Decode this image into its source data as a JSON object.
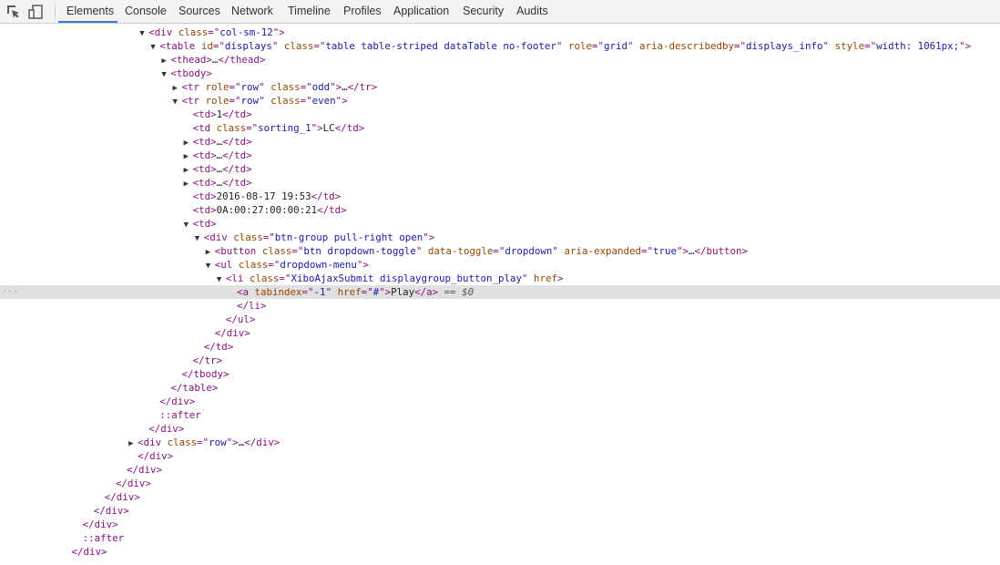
{
  "toolbar": {
    "icons": [
      "inspect-icon",
      "device-mode-icon"
    ],
    "tabs": [
      "Elements",
      "Console",
      "Sources",
      "Network",
      "Timeline",
      "Profiles",
      "Application",
      "Security",
      "Audits"
    ],
    "active_tab": "Elements",
    "accent": "#3879d9"
  },
  "tree": {
    "lines": [
      {
        "indent": 12,
        "tri": "open",
        "parts": [
          [
            "tag",
            "<div "
          ],
          [
            "attr",
            "class"
          ],
          [
            "tag",
            "=\""
          ],
          [
            "val",
            "col-sm-12"
          ],
          [
            "tag",
            "\">"
          ]
        ]
      },
      {
        "indent": 13,
        "tri": "open",
        "parts": [
          [
            "tag",
            "<table "
          ],
          [
            "attr",
            "id"
          ],
          [
            "tag",
            "=\""
          ],
          [
            "val",
            "displays"
          ],
          [
            "tag",
            "\" "
          ],
          [
            "attr",
            "class"
          ],
          [
            "tag",
            "=\""
          ],
          [
            "val",
            "table table-striped dataTable no-footer"
          ],
          [
            "tag",
            "\" "
          ],
          [
            "attr",
            "role"
          ],
          [
            "tag",
            "=\""
          ],
          [
            "val",
            "grid"
          ],
          [
            "tag",
            "\" "
          ],
          [
            "attr",
            "aria-describedby"
          ],
          [
            "tag",
            "=\""
          ],
          [
            "val",
            "displays_info"
          ],
          [
            "tag",
            "\" "
          ],
          [
            "attr",
            "style"
          ],
          [
            "tag",
            "=\""
          ],
          [
            "val",
            "width: 1061px;"
          ],
          [
            "tag",
            "\">"
          ]
        ]
      },
      {
        "indent": 14,
        "tri": "closed",
        "parts": [
          [
            "tag",
            "<thead>"
          ],
          [
            "txt",
            "…"
          ],
          [
            "tag",
            "</thead>"
          ]
        ]
      },
      {
        "indent": 14,
        "tri": "open",
        "parts": [
          [
            "tag",
            "<tbody>"
          ]
        ]
      },
      {
        "indent": 15,
        "tri": "closed",
        "parts": [
          [
            "tag",
            "<tr "
          ],
          [
            "attr",
            "role"
          ],
          [
            "tag",
            "=\""
          ],
          [
            "val",
            "row"
          ],
          [
            "tag",
            "\" "
          ],
          [
            "attr",
            "class"
          ],
          [
            "tag",
            "=\""
          ],
          [
            "val",
            "odd"
          ],
          [
            "tag",
            "\">"
          ],
          [
            "txt",
            "…"
          ],
          [
            "tag",
            "</tr>"
          ]
        ]
      },
      {
        "indent": 15,
        "tri": "open",
        "parts": [
          [
            "tag",
            "<tr "
          ],
          [
            "attr",
            "role"
          ],
          [
            "tag",
            "=\""
          ],
          [
            "val",
            "row"
          ],
          [
            "tag",
            "\" "
          ],
          [
            "attr",
            "class"
          ],
          [
            "tag",
            "=\""
          ],
          [
            "val",
            "even"
          ],
          [
            "tag",
            "\">"
          ]
        ]
      },
      {
        "indent": 16,
        "tri": "none",
        "parts": [
          [
            "tag",
            "<td>"
          ],
          [
            "txt",
            "1"
          ],
          [
            "tag",
            "</td>"
          ]
        ]
      },
      {
        "indent": 16,
        "tri": "none",
        "parts": [
          [
            "tag",
            "<td "
          ],
          [
            "attr",
            "class"
          ],
          [
            "tag",
            "=\""
          ],
          [
            "val",
            "sorting_1"
          ],
          [
            "tag",
            "\">"
          ],
          [
            "txt",
            "LC"
          ],
          [
            "tag",
            "</td>"
          ]
        ]
      },
      {
        "indent": 16,
        "tri": "closed",
        "parts": [
          [
            "tag",
            "<td>"
          ],
          [
            "txt",
            "…"
          ],
          [
            "tag",
            "</td>"
          ]
        ]
      },
      {
        "indent": 16,
        "tri": "closed",
        "parts": [
          [
            "tag",
            "<td>"
          ],
          [
            "txt",
            "…"
          ],
          [
            "tag",
            "</td>"
          ]
        ]
      },
      {
        "indent": 16,
        "tri": "closed",
        "parts": [
          [
            "tag",
            "<td>"
          ],
          [
            "txt",
            "…"
          ],
          [
            "tag",
            "</td>"
          ]
        ]
      },
      {
        "indent": 16,
        "tri": "closed",
        "parts": [
          [
            "tag",
            "<td>"
          ],
          [
            "txt",
            "…"
          ],
          [
            "tag",
            "</td>"
          ]
        ]
      },
      {
        "indent": 16,
        "tri": "none",
        "parts": [
          [
            "tag",
            "<td>"
          ],
          [
            "txt",
            "2016-08-17 19:53"
          ],
          [
            "tag",
            "</td>"
          ]
        ]
      },
      {
        "indent": 16,
        "tri": "none",
        "parts": [
          [
            "tag",
            "<td>"
          ],
          [
            "txt",
            "0A:00:27:00:00:21"
          ],
          [
            "tag",
            "</td>"
          ]
        ]
      },
      {
        "indent": 16,
        "tri": "open",
        "parts": [
          [
            "tag",
            "<td>"
          ]
        ]
      },
      {
        "indent": 17,
        "tri": "open",
        "parts": [
          [
            "tag",
            "<div "
          ],
          [
            "attr",
            "class"
          ],
          [
            "tag",
            "=\""
          ],
          [
            "val",
            "btn-group pull-right open"
          ],
          [
            "tag",
            "\">"
          ]
        ]
      },
      {
        "indent": 18,
        "tri": "closed",
        "parts": [
          [
            "tag",
            "<button "
          ],
          [
            "attr",
            "class"
          ],
          [
            "tag",
            "=\""
          ],
          [
            "val",
            "btn dropdown-toggle"
          ],
          [
            "tag",
            "\" "
          ],
          [
            "attr",
            "data-toggle"
          ],
          [
            "tag",
            "=\""
          ],
          [
            "val",
            "dropdown"
          ],
          [
            "tag",
            "\" "
          ],
          [
            "attr",
            "aria-expanded"
          ],
          [
            "tag",
            "=\""
          ],
          [
            "val",
            "true"
          ],
          [
            "tag",
            "\">"
          ],
          [
            "txt",
            "…"
          ],
          [
            "tag",
            "</button>"
          ]
        ]
      },
      {
        "indent": 18,
        "tri": "open",
        "parts": [
          [
            "tag",
            "<ul "
          ],
          [
            "attr",
            "class"
          ],
          [
            "tag",
            "=\""
          ],
          [
            "val",
            "dropdown-menu"
          ],
          [
            "tag",
            "\">"
          ]
        ]
      },
      {
        "indent": 19,
        "tri": "open",
        "parts": [
          [
            "tag",
            "<li "
          ],
          [
            "attr",
            "class"
          ],
          [
            "tag",
            "=\""
          ],
          [
            "val",
            "XiboAjaxSubmit displaygroup_button_play"
          ],
          [
            "tag",
            "\" "
          ],
          [
            "attr",
            "href"
          ],
          [
            "tag",
            ">"
          ]
        ]
      },
      {
        "indent": 20,
        "tri": "none",
        "selected": true,
        "parts": [
          [
            "tag",
            "<a "
          ],
          [
            "attr",
            "tabindex"
          ],
          [
            "tag",
            "=\""
          ],
          [
            "val",
            "-1"
          ],
          [
            "tag",
            "\" "
          ],
          [
            "attr",
            "href"
          ],
          [
            "tag",
            "=\""
          ],
          [
            "val",
            "#"
          ],
          [
            "tag",
            "\">"
          ],
          [
            "txt",
            "Play"
          ],
          [
            "tag",
            "</a>"
          ],
          [
            "ref",
            " == $0"
          ]
        ]
      },
      {
        "indent": 20,
        "tri": "none",
        "parts": [
          [
            "tag",
            "</li>"
          ]
        ]
      },
      {
        "indent": 19,
        "tri": "none",
        "parts": [
          [
            "tag",
            "</ul>"
          ]
        ]
      },
      {
        "indent": 18,
        "tri": "none",
        "parts": [
          [
            "tag",
            "</div>"
          ]
        ]
      },
      {
        "indent": 17,
        "tri": "none",
        "parts": [
          [
            "tag",
            "</td>"
          ]
        ]
      },
      {
        "indent": 16,
        "tri": "none",
        "parts": [
          [
            "tag",
            "</tr>"
          ]
        ]
      },
      {
        "indent": 15,
        "tri": "none",
        "parts": [
          [
            "tag",
            "</tbody>"
          ]
        ]
      },
      {
        "indent": 14,
        "tri": "none",
        "parts": [
          [
            "tag",
            "</table>"
          ]
        ]
      },
      {
        "indent": 13,
        "tri": "none",
        "parts": [
          [
            "tag",
            "</div>"
          ]
        ]
      },
      {
        "indent": 13,
        "tri": "none",
        "parts": [
          [
            "pseudo",
            "::after"
          ]
        ]
      },
      {
        "indent": 12,
        "tri": "none",
        "parts": [
          [
            "tag",
            "</div>"
          ]
        ]
      },
      {
        "indent": 11,
        "tri": "closed",
        "parts": [
          [
            "tag",
            "<div "
          ],
          [
            "attr",
            "class"
          ],
          [
            "tag",
            "=\""
          ],
          [
            "val",
            "row"
          ],
          [
            "tag",
            "\">"
          ],
          [
            "txt",
            "…"
          ],
          [
            "tag",
            "</div>"
          ]
        ]
      },
      {
        "indent": 11,
        "tri": "none",
        "parts": [
          [
            "tag",
            "</div>"
          ]
        ]
      },
      {
        "indent": 10,
        "tri": "none",
        "parts": [
          [
            "tag",
            "</div>"
          ]
        ]
      },
      {
        "indent": 9,
        "tri": "none",
        "parts": [
          [
            "tag",
            "</div>"
          ]
        ]
      },
      {
        "indent": 8,
        "tri": "none",
        "parts": [
          [
            "tag",
            "</div>"
          ]
        ]
      },
      {
        "indent": 7,
        "tri": "none",
        "parts": [
          [
            "tag",
            "</div>"
          ]
        ]
      },
      {
        "indent": 6,
        "tri": "none",
        "parts": [
          [
            "tag",
            "</div>"
          ]
        ]
      },
      {
        "indent": 6,
        "tri": "none",
        "parts": [
          [
            "pseudo",
            "::after"
          ]
        ]
      },
      {
        "indent": 5,
        "tri": "none",
        "parts": [
          [
            "tag",
            "</div>"
          ]
        ]
      }
    ]
  }
}
